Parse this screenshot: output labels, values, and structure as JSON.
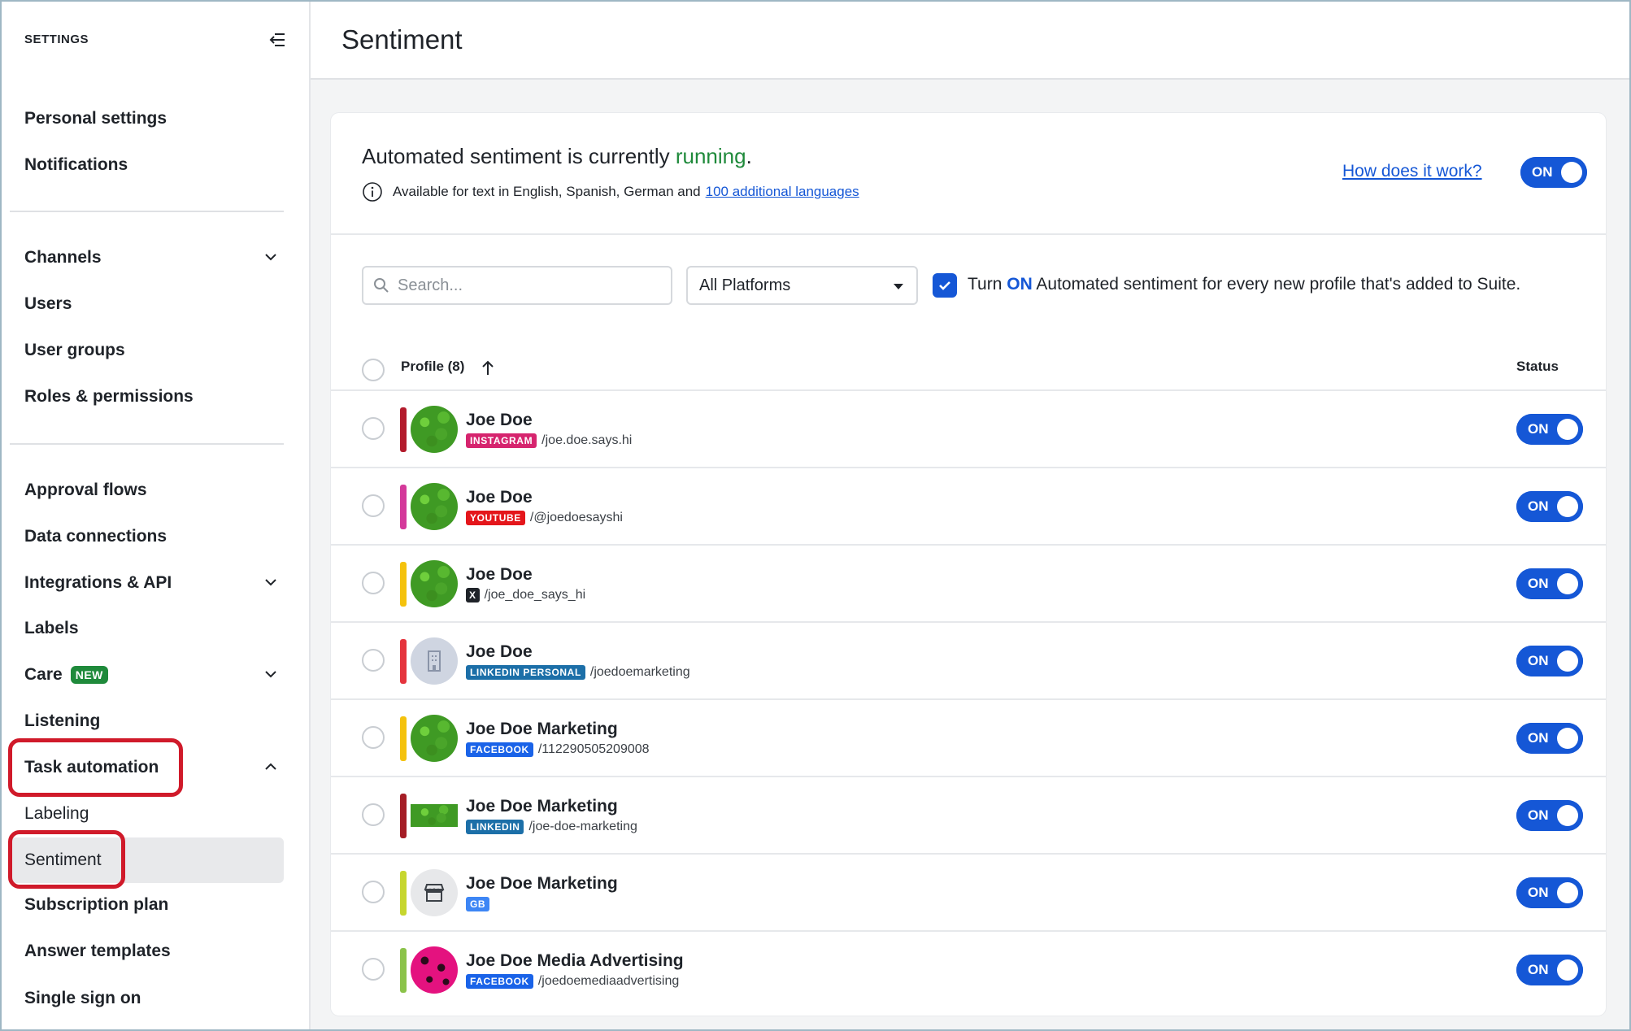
{
  "sidebar": {
    "heading": "SETTINGS",
    "groups": [
      [
        {
          "label": "Personal settings"
        },
        {
          "label": "Notifications"
        }
      ],
      [
        {
          "label": "Channels",
          "expandable": true,
          "expanded": false
        },
        {
          "label": "Users"
        },
        {
          "label": "User groups"
        },
        {
          "label": "Roles & permissions"
        }
      ],
      [
        {
          "label": "Approval flows"
        },
        {
          "label": "Data connections"
        },
        {
          "label": "Integrations & API",
          "expandable": true,
          "expanded": false
        },
        {
          "label": "Labels"
        },
        {
          "label": "Care",
          "badge": "NEW",
          "expandable": true,
          "expanded": false
        },
        {
          "label": "Listening"
        },
        {
          "label": "Task automation",
          "expandable": true,
          "expanded": true,
          "highlighted": true
        },
        {
          "label": "Labeling",
          "sub": true
        },
        {
          "label": "Sentiment",
          "sub": true,
          "active": true,
          "highlighted": true
        },
        {
          "label": "Subscription plan"
        },
        {
          "label": "Answer templates"
        },
        {
          "label": "Single sign on"
        }
      ]
    ]
  },
  "page": {
    "title": "Sentiment"
  },
  "status": {
    "prefix": "Automated sentiment is currently ",
    "state": "running",
    "suffix": ".",
    "available_prefix": "Available for text in English, Spanish, German and",
    "available_link": "100 additional languages",
    "how_link": "How does it work?",
    "toggle": "ON"
  },
  "filters": {
    "search_placeholder": "Search...",
    "platform_select": "All Platforms",
    "auto_checkbox_checked": true,
    "auto_text_before": "Turn ",
    "auto_text_on": "ON",
    "auto_text_after": " Automated sentiment for every new profile that's added to Suite."
  },
  "table": {
    "header_profile": "Profile (8)",
    "header_status": "Status",
    "rows": [
      {
        "name": "Joe Doe",
        "platform": "INSTAGRAM",
        "platform_color": "#d6246e",
        "handle": "/joe.doe.says.hi",
        "bar_color": "#b31b2c",
        "avatar": "moss",
        "status": "ON"
      },
      {
        "name": "Joe Doe",
        "platform": "YOUTUBE",
        "platform_color": "#e4161b",
        "handle": "/@joedoesayshi",
        "bar_color": "#d4399a",
        "avatar": "moss",
        "status": "ON"
      },
      {
        "name": "Joe Doe",
        "platform": "X",
        "platform_color": "#1f2329",
        "handle": "/joe_doe_says_hi",
        "bar_color": "#f4c20d",
        "avatar": "moss",
        "status": "ON"
      },
      {
        "name": "Joe Doe",
        "platform": "LINKEDIN PERSONAL",
        "platform_color": "#1c6fa8",
        "handle": "/joedoemarketing",
        "bar_color": "#e5343d",
        "avatar": "building",
        "status": "ON"
      },
      {
        "name": "Joe Doe Marketing",
        "platform": "FACEBOOK",
        "platform_color": "#1a63e8",
        "handle": "/112290505209008",
        "bar_color": "#f4c20d",
        "avatar": "moss",
        "status": "ON"
      },
      {
        "name": "Joe Doe Marketing",
        "platform": "LINKEDIN",
        "platform_color": "#1c6fa8",
        "handle": "/joe-doe-marketing",
        "bar_color": "#a51d26",
        "avatar": "moss-rect",
        "status": "ON"
      },
      {
        "name": "Joe Doe Marketing",
        "platform": "GB",
        "platform_color": "#3d86f5",
        "handle": "",
        "bar_color": "#c6d62e",
        "avatar": "store",
        "status": "ON"
      },
      {
        "name": "Joe Doe Media Advertising",
        "platform": "FACEBOOK",
        "platform_color": "#1a63e8",
        "handle": "/joedoemediaadvertising",
        "bar_color": "#8bc34a",
        "avatar": "pink",
        "status": "ON"
      }
    ]
  },
  "colors": {
    "accent": "#1557d6",
    "running": "#1f8a3b",
    "highlight": "#d01a2a"
  }
}
